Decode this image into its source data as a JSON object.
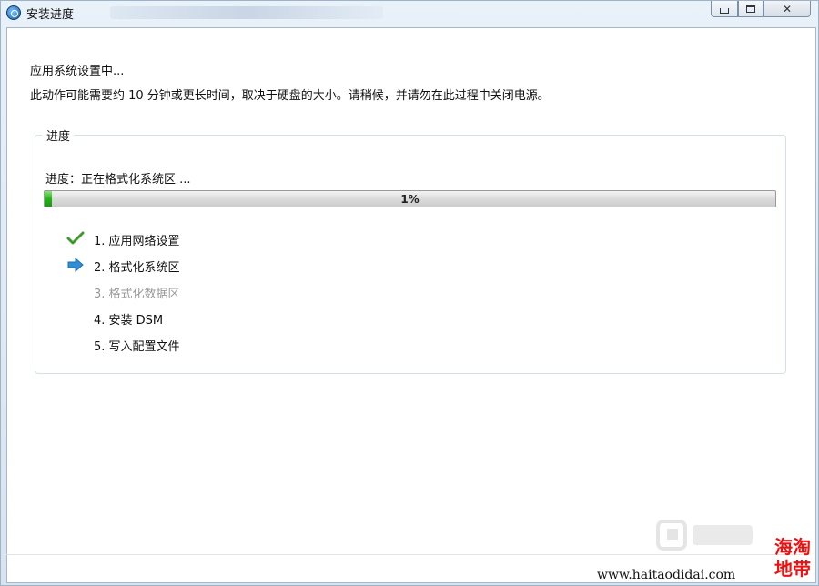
{
  "window": {
    "title": "安装进度",
    "close_symbol": "✕"
  },
  "header": {
    "status": "应用系统设置中...",
    "info": "此动作可能需要约 10 分钟或更长时间，取决于硬盘的大小。请稍候，并请勿在此过程中关闭电源。"
  },
  "progress_group": {
    "title": "进度",
    "label": "进度：正在格式化系统区 ...",
    "percent_text": "1%",
    "percent_value": 1,
    "fill_color": "#27b01c"
  },
  "steps": [
    {
      "label": "1. 应用网络设置",
      "state": "done",
      "icon": "check-icon"
    },
    {
      "label": "2. 格式化系统区",
      "state": "current",
      "icon": "arrow-right-icon"
    },
    {
      "label": "3. 格式化数据区",
      "state": "pending",
      "icon": ""
    },
    {
      "label": "4. 安装 DSM",
      "state": "pending",
      "icon": ""
    },
    {
      "label": "5. 写入配置文件",
      "state": "pending",
      "icon": ""
    }
  ],
  "watermark": {
    "url": "www.haitaodidai.com",
    "seal": "海淘地带"
  },
  "colors": {
    "check": "#3c9a2a",
    "arrow": "#2f8fd6"
  }
}
